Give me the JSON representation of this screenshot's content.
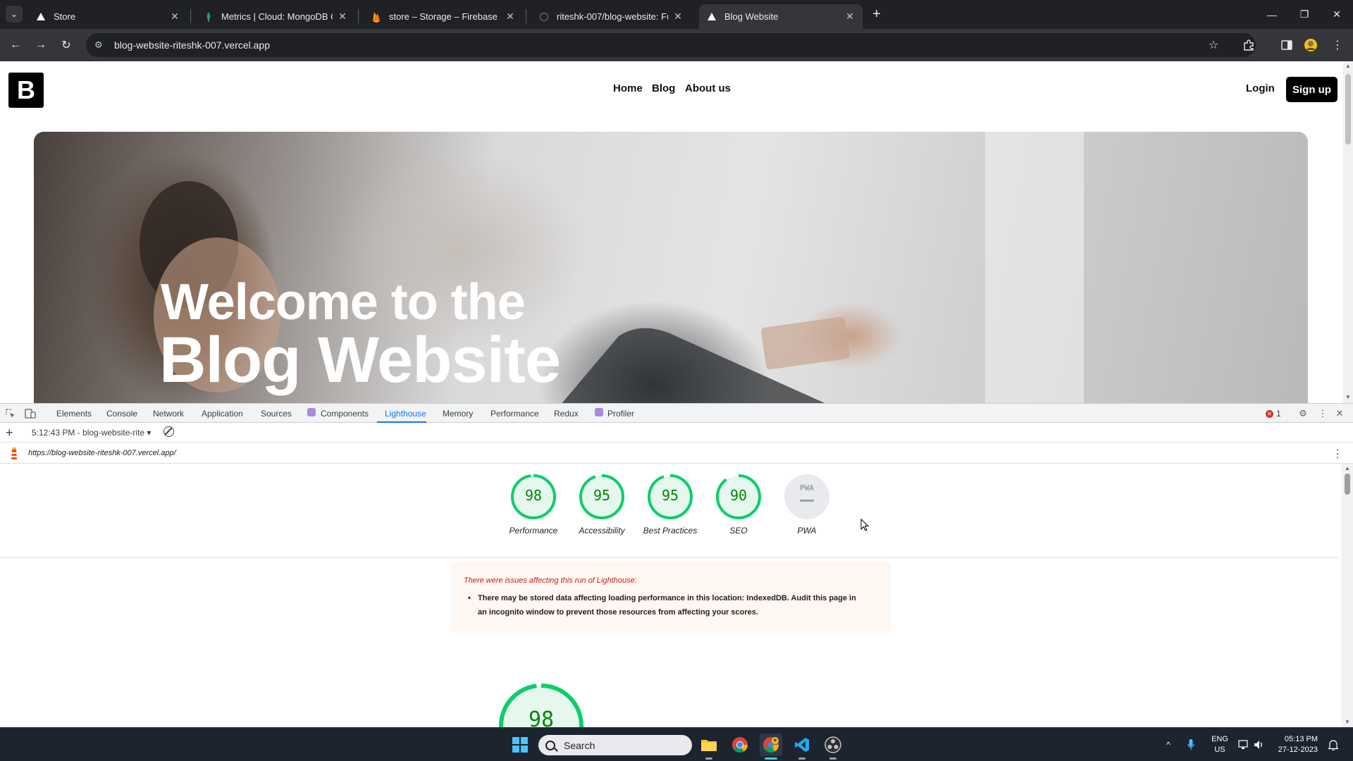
{
  "browser": {
    "tabs": [
      {
        "title": "Store",
        "active": false
      },
      {
        "title": "Metrics | Cloud: MongoDB Clou",
        "active": false
      },
      {
        "title": "store – Storage – Firebase cons",
        "active": false
      },
      {
        "title": "riteshk-007/blog-website: Full S",
        "active": false
      },
      {
        "title": "Blog Website",
        "active": true
      }
    ],
    "url": "blog-website-riteshk-007.vercel.app"
  },
  "site": {
    "logo": "B",
    "nav": {
      "home": "Home",
      "blog": "Blog",
      "about": "About us"
    },
    "login": "Login",
    "signup": "Sign up",
    "hero_line1": "Welcome to the",
    "hero_line2": "Blog Website"
  },
  "devtools": {
    "tabs": [
      "Elements",
      "Console",
      "Network",
      "Application",
      "Sources",
      "Components",
      "Lighthouse",
      "Memory",
      "Performance",
      "Redux",
      "Profiler"
    ],
    "active_tab": "Lighthouse",
    "error_count": "1",
    "report_label": "5:12:43 PM - blog-website-rite",
    "report_url": "https://blog-website-riteshk-007.vercel.app/",
    "scores": [
      {
        "label": "Performance",
        "value": 98
      },
      {
        "label": "Accessibility",
        "value": 95
      },
      {
        "label": "Best Practices",
        "value": 95
      },
      {
        "label": "SEO",
        "value": 90
      }
    ],
    "pwa": {
      "label": "PWA",
      "badge": "PWA"
    },
    "warning_title": "There were issues affecting this run of Lighthouse:",
    "warning_item": "There may be stored data affecting loading performance in this location: IndexedDB. Audit this page in an incognito window to prevent those resources from affecting your scores.",
    "big_score": 98,
    "score_color": "#0cce6b"
  },
  "taskbar": {
    "search_placeholder": "Search",
    "lang_line1": "ENG",
    "lang_line2": "US",
    "time": "05:13 PM",
    "date": "27-12-2023"
  }
}
